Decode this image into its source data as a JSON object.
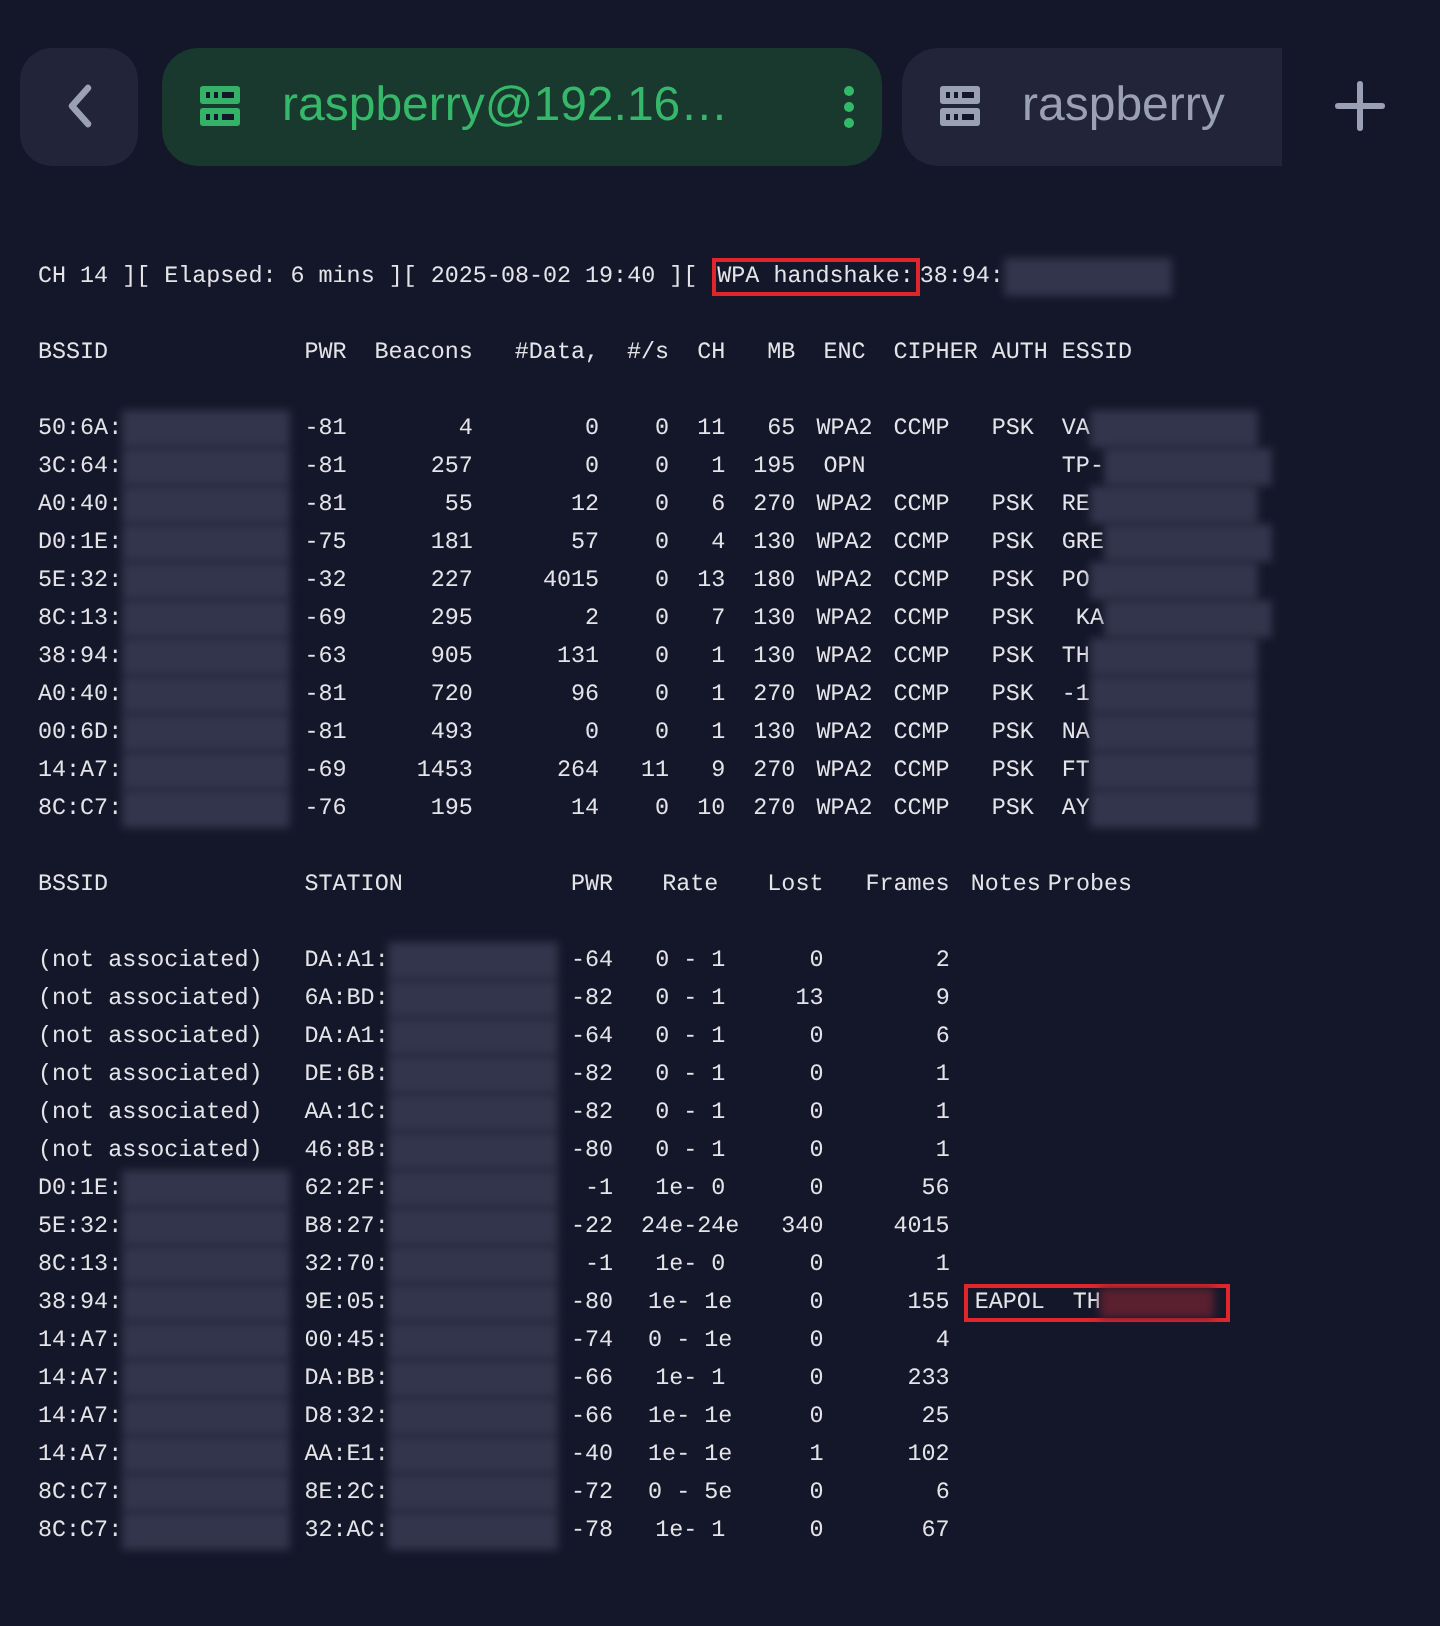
{
  "tabs": [
    {
      "label": "raspberry@192.16…",
      "selected": true
    },
    {
      "label": "raspberry",
      "selected": false
    }
  ],
  "status_line": {
    "prefix": "CH 14 ][ Elapsed: 6 mins ][ 2025-08-02 19:40 ][ ",
    "highlight": "WPA handshake:",
    "suffix": "38:94:"
  },
  "ap_table": {
    "columns": [
      "BSSID",
      "PWR",
      "Beacons",
      "#Data,",
      "#/s",
      "CH",
      "MB",
      "ENC",
      "CIPHER",
      "AUTH",
      "ESSID"
    ],
    "rows": [
      {
        "bssid": "50:6A:",
        "pwr": "-81",
        "beacons": "4",
        "data": "0",
        "per_s": "0",
        "ch": "11",
        "mb": "65",
        "enc": "WPA2",
        "cipher": "CCMP",
        "auth": "PSK",
        "essid": "VA"
      },
      {
        "bssid": "3C:64:",
        "pwr": "-81",
        "beacons": "257",
        "data": "0",
        "per_s": "0",
        "ch": "1",
        "mb": "195",
        "enc": "OPN",
        "essid": "TP-"
      },
      {
        "bssid": "A0:40:",
        "pwr": "-81",
        "beacons": "55",
        "data": "12",
        "per_s": "0",
        "ch": "6",
        "mb": "270",
        "enc": "WPA2",
        "cipher": "CCMP",
        "auth": "PSK",
        "essid": "RE"
      },
      {
        "bssid": "D0:1E:",
        "pwr": "-75",
        "beacons": "181",
        "data": "57",
        "per_s": "0",
        "ch": "4",
        "mb": "130",
        "enc": "WPA2",
        "cipher": "CCMP",
        "auth": "PSK",
        "essid": "GRE"
      },
      {
        "bssid": "5E:32:",
        "pwr": "-32",
        "beacons": "227",
        "data": "4015",
        "per_s": "0",
        "ch": "13",
        "mb": "180",
        "enc": "WPA2",
        "cipher": "CCMP",
        "auth": "PSK",
        "essid": "PO"
      },
      {
        "bssid": "8C:13:",
        "pwr": "-69",
        "beacons": "295",
        "data": "2",
        "per_s": "0",
        "ch": "7",
        "mb": "130",
        "enc": "WPA2",
        "cipher": "CCMP",
        "auth": "PSK",
        "essid": " KA"
      },
      {
        "bssid": "38:94:",
        "pwr": "-63",
        "beacons": "905",
        "data": "131",
        "per_s": "0",
        "ch": "1",
        "mb": "130",
        "enc": "WPA2",
        "cipher": "CCMP",
        "auth": "PSK",
        "essid": "TH"
      },
      {
        "bssid": "A0:40:",
        "pwr": "-81",
        "beacons": "720",
        "data": "96",
        "per_s": "0",
        "ch": "1",
        "mb": "270",
        "enc": "WPA2",
        "cipher": "CCMP",
        "auth": "PSK",
        "essid": "-1"
      },
      {
        "bssid": "00:6D:",
        "pwr": "-81",
        "beacons": "493",
        "data": "0",
        "per_s": "0",
        "ch": "1",
        "mb": "130",
        "enc": "WPA2",
        "cipher": "CCMP",
        "auth": "PSK",
        "essid": "NA"
      },
      {
        "bssid": "14:A7:",
        "pwr": "-69",
        "beacons": "1453",
        "data": "264",
        "per_s": "11",
        "ch": "9",
        "mb": "270",
        "enc": "WPA2",
        "cipher": "CCMP",
        "auth": "PSK",
        "essid": "FT"
      },
      {
        "bssid": "8C:C7:",
        "pwr": "-76",
        "beacons": "195",
        "data": "14",
        "per_s": "0",
        "ch": "10",
        "mb": "270",
        "enc": "WPA2",
        "cipher": "CCMP",
        "auth": "PSK",
        "essid": "AY"
      }
    ]
  },
  "station_table": {
    "columns": [
      "BSSID",
      "STATION",
      "PWR",
      "Rate",
      "Lost",
      "Frames",
      "Notes",
      "Probes"
    ],
    "rows": [
      {
        "bssid": "(not associated)",
        "station": "DA:A1:",
        "pwr": "-64",
        "rate": "0 - 1",
        "lost": "0",
        "frames": "2",
        "highlighted": false
      },
      {
        "bssid": "(not associated)",
        "station": "6A:BD:",
        "pwr": "-82",
        "rate": "0 - 1",
        "lost": "13",
        "frames": "9",
        "highlighted": false
      },
      {
        "bssid": "(not associated)",
        "station": "DA:A1:",
        "pwr": "-64",
        "rate": "0 - 1",
        "lost": "0",
        "frames": "6",
        "highlighted": false
      },
      {
        "bssid": "(not associated)",
        "station": "DE:6B:",
        "pwr": "-82",
        "rate": "0 - 1",
        "lost": "0",
        "frames": "1",
        "highlighted": false
      },
      {
        "bssid": "(not associated)",
        "station": "AA:1C:",
        "pwr": "-82",
        "rate": "0 - 1",
        "lost": "0",
        "frames": "1",
        "highlighted": false
      },
      {
        "bssid": "(not associated)",
        "station": "46:8B:",
        "pwr": "-80",
        "rate": "0 - 1",
        "lost": "0",
        "frames": "1",
        "highlighted": false
      },
      {
        "bssid": "D0:1E:",
        "station": "62:2F:",
        "pwr": "-1",
        "rate": "1e- 0",
        "lost": "0",
        "frames": "56",
        "highlighted": false
      },
      {
        "bssid": "5E:32:",
        "station": "B8:27:",
        "pwr": "-22",
        "rate": "24e-24e",
        "lost": "340",
        "frames": "4015",
        "highlighted": false
      },
      {
        "bssid": "8C:13:",
        "station": "32:70:",
        "pwr": "-1",
        "rate": "1e- 0",
        "lost": "0",
        "frames": "1",
        "highlighted": false
      },
      {
        "bssid": "38:94:",
        "station": "9E:05:",
        "pwr": "-80",
        "rate": "1e- 1e",
        "lost": "0",
        "frames": "155",
        "notes": "EAPOL",
        "probes": "TH",
        "highlighted": true
      },
      {
        "bssid": "14:A7:",
        "station": "00:45:",
        "pwr": "-74",
        "rate": "0 - 1e",
        "lost": "0",
        "frames": "4",
        "highlighted": false
      },
      {
        "bssid": "14:A7:",
        "station": "DA:BB:",
        "pwr": "-66",
        "rate": "1e- 1",
        "lost": "0",
        "frames": "233",
        "highlighted": false
      },
      {
        "bssid": "14:A7:",
        "station": "D8:32:",
        "pwr": "-66",
        "rate": "1e- 1e",
        "lost": "0",
        "frames": "25",
        "highlighted": false
      },
      {
        "bssid": "14:A7:",
        "station": "AA:E1:",
        "pwr": "-40",
        "rate": "1e- 1e",
        "lost": "1",
        "frames": "102",
        "highlighted": false
      },
      {
        "bssid": "8C:C7:",
        "station": "8E:2C:",
        "pwr": "-72",
        "rate": "0 - 5e",
        "lost": "0",
        "frames": "6",
        "highlighted": false
      },
      {
        "bssid": "8C:C7:",
        "station": "32:AC:",
        "pwr": "-78",
        "rate": "1e- 1",
        "lost": "0",
        "frames": "67",
        "highlighted": false
      }
    ]
  }
}
